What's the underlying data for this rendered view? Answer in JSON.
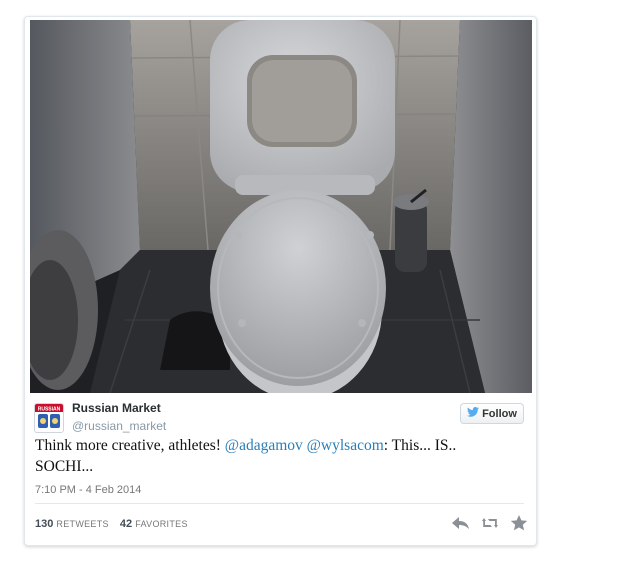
{
  "tweet": {
    "author_name": "Russian Market",
    "author_handle": "@russian_market",
    "follow_label": "Follow",
    "text_segments": {
      "lead": "Think more creative, athletes! ",
      "mention1": "@adagamov",
      "space": " ",
      "mention2": "@wylsacom",
      "tail": ": This... IS.. SOCHI..."
    },
    "timestamp": "7:10 PM - 4 Feb 2014",
    "retweets_count": "130",
    "retweets_label": "RETWEETS",
    "favorites_count": "42",
    "favorites_label": "FAVORITES",
    "avatar_text": "RUSSIAN"
  },
  "colors": {
    "link": "#2a7fb8",
    "twitter_bird": "#55acee",
    "meta": "#777777"
  },
  "icons": {
    "follow": "twitter-bird-icon",
    "reply": "reply-icon",
    "retweet": "retweet-icon",
    "favorite": "star-icon"
  }
}
